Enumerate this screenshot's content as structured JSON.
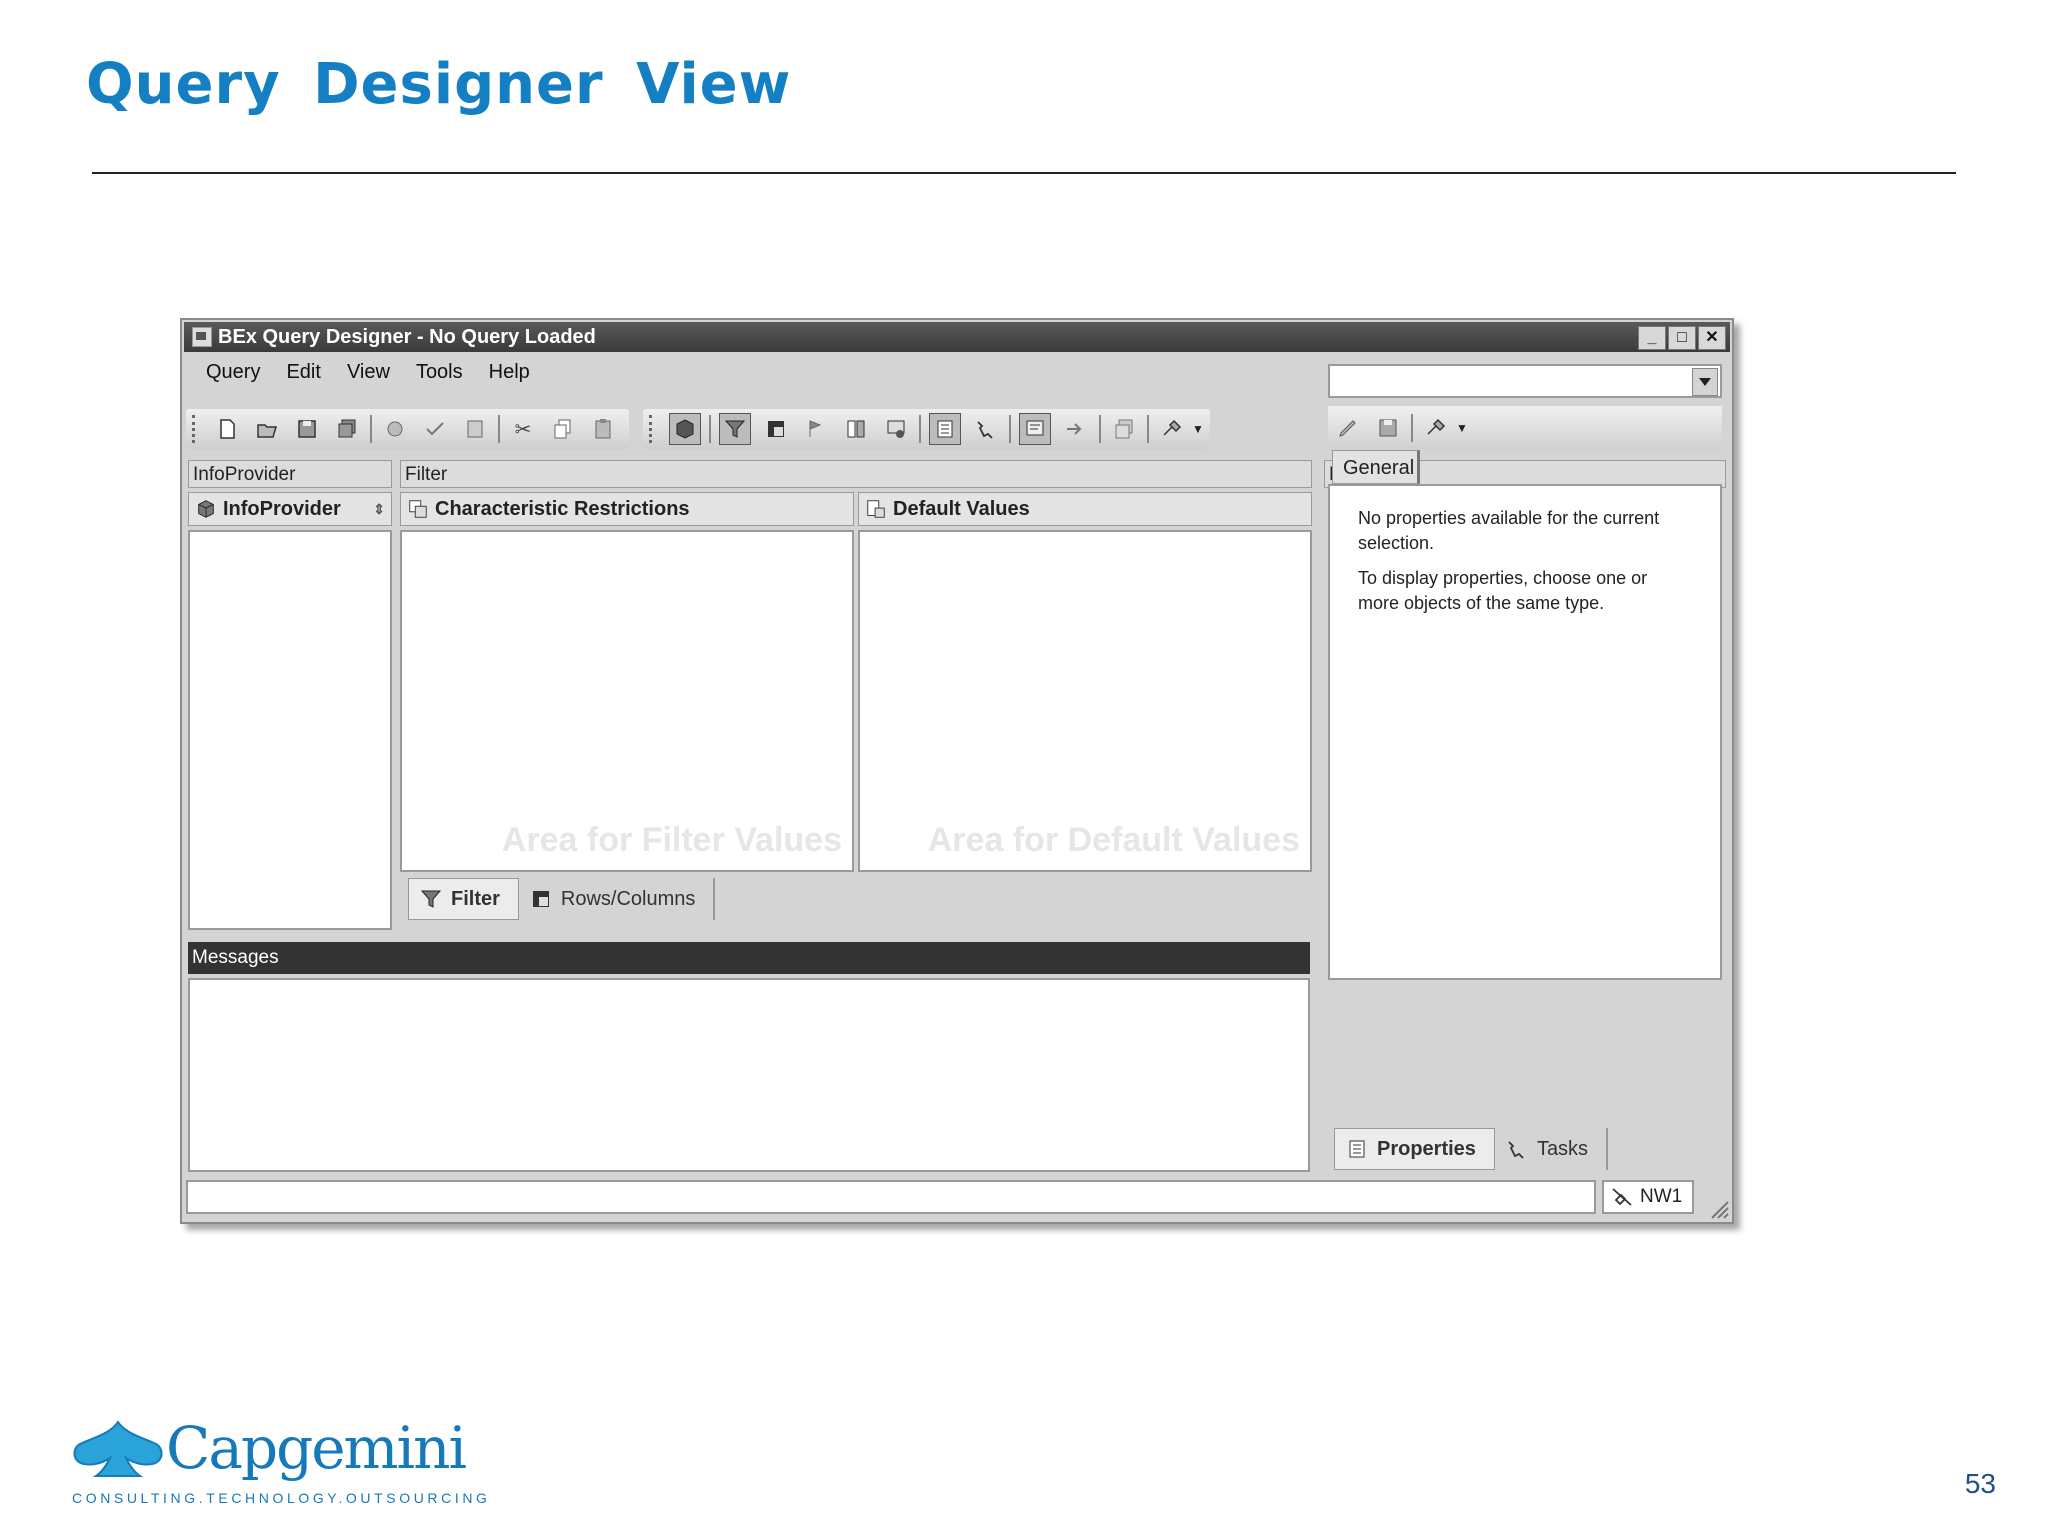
{
  "slide": {
    "title": "Query  Designer View",
    "page_number": "53"
  },
  "logo": {
    "name": "Capgemini",
    "tagline": "CONSULTING.TECHNOLOGY.OUTSOURCING"
  },
  "window": {
    "title": "BEx Query Designer - No Query Loaded",
    "controls": {
      "minimize": "_",
      "maximize": "□",
      "close": "✕"
    }
  },
  "menu": [
    "Query",
    "Edit",
    "View",
    "Tools",
    "Help"
  ],
  "panels": {
    "infoprovider": {
      "header": "InfoProvider",
      "subheader": "InfoProvider"
    },
    "filter": {
      "header": "Filter",
      "char_restrictions": "Characteristic Restrictions",
      "default_values": "Default Values",
      "char_watermark": "Area for Filter Values",
      "default_watermark": "Area for Default Values",
      "tabs": [
        "Filter",
        "Rows/Columns"
      ],
      "active_tab": "Filter"
    },
    "messages": {
      "header": "Messages"
    },
    "properties": {
      "header": "Properties",
      "tab": "General",
      "text1": "No properties available for the current selection.",
      "text2": "To display properties, choose one or more objects of the same type.",
      "bottom_tabs": [
        "Properties",
        "Tasks"
      ],
      "active_bottom_tab": "Properties"
    }
  },
  "status": {
    "system": "NW1"
  }
}
